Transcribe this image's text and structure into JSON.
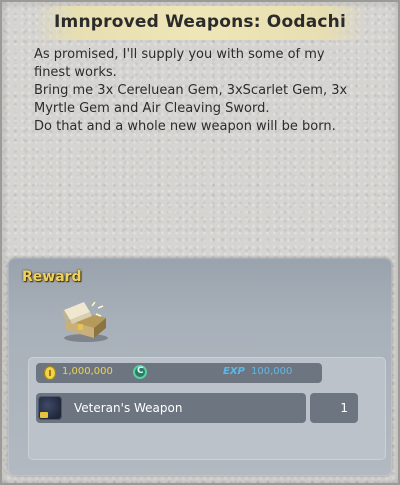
{
  "quest": {
    "title": "Imnproved Weapons: Oodachi",
    "description_lines": [
      "As promised, I'll supply you with some of my",
      "finest works.",
      "Bring me 3x Cereluean Gem, 3xScarlet Gem, 3x",
      "Myrtle Gem and Air Cleaving Sword.",
      "Do that and a whole new weapon will be born."
    ]
  },
  "reward": {
    "label": "Reward",
    "chest_icon": "treasure-chest-icon",
    "gold": "1,000,000",
    "coin_icon": "gold-coin-icon",
    "cp_icon": "cp-token-icon",
    "exp_label": "EXP",
    "exp": "100,000",
    "items": [
      {
        "name": "Veteran's Weapon",
        "quantity": "1",
        "icon": "weapon-crate-icon"
      }
    ]
  },
  "colors": {
    "reward_label": "#f0d25a",
    "gold_text": "#f1d24a",
    "exp_text": "#5db8e9",
    "panel": "#a8b0b9"
  }
}
